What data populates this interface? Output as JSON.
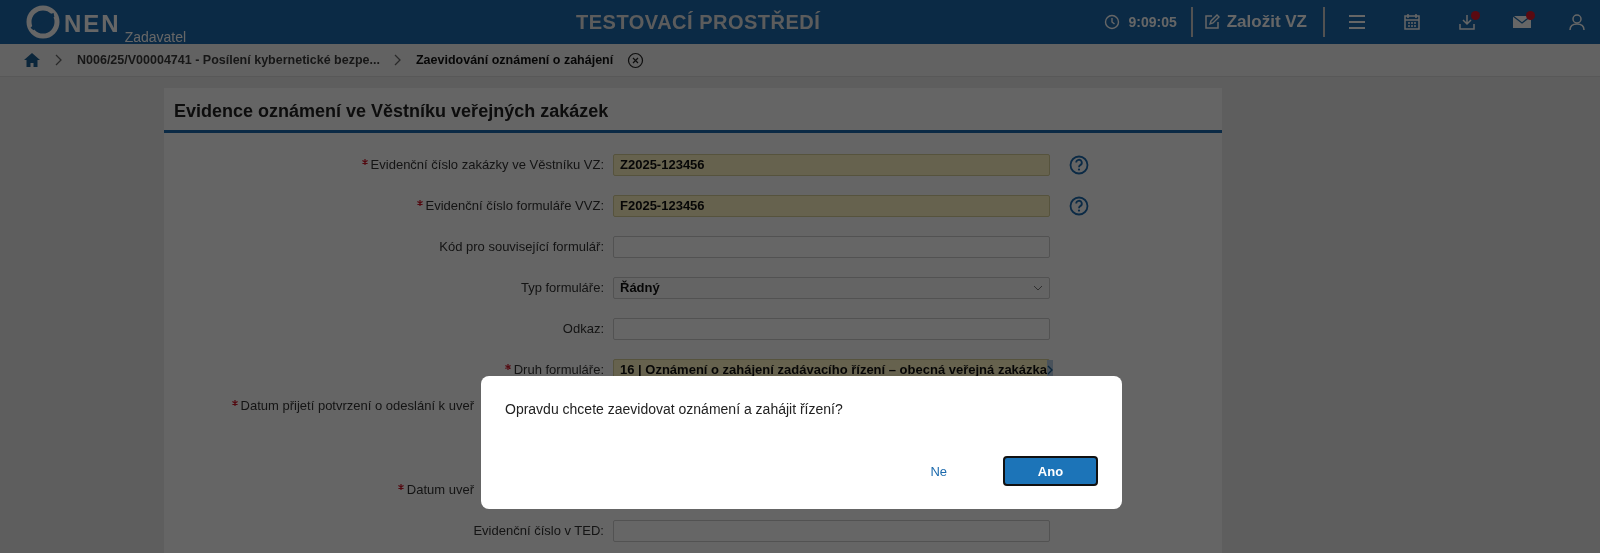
{
  "header": {
    "logo": "NEN",
    "subtitle": "Zadavatel",
    "title": "TESTOVACÍ PROSTŘEDÍ",
    "time": "9:09:05",
    "create_label": "Založit VZ",
    "icons": [
      {
        "kind": "menu",
        "notification": false
      },
      {
        "kind": "calendar",
        "notification": false
      },
      {
        "kind": "download",
        "notification": true
      },
      {
        "kind": "mail",
        "notification": true
      },
      {
        "kind": "user",
        "notification": false
      }
    ]
  },
  "breadcrumb": {
    "items": [
      "N006/25/V00004741 - Posílení kybernetické bezpe...",
      "Zaevidování oznámení o zahájení"
    ]
  },
  "form": {
    "title": "Evidence oznámení ve Věstníku veřejných zakázek",
    "fields": [
      {
        "kind": "text",
        "label": "Evidenční číslo zakázky ve Věstníku VZ:",
        "required": true,
        "value": "Z2025-123456",
        "help": true
      },
      {
        "kind": "text",
        "label": "Evidenční číslo formuláře VVZ:",
        "required": true,
        "value": "F2025-123456",
        "help": true
      },
      {
        "kind": "text",
        "label": "Kód pro související formulář:",
        "required": false,
        "help": false
      },
      {
        "kind": "select",
        "label": "Typ formuláře:",
        "required": false,
        "value": "Řádný",
        "help": false
      },
      {
        "kind": "text",
        "label": "Odkaz:",
        "required": false,
        "help": false
      },
      {
        "kind": "code",
        "label": "Druh formuláře:",
        "required": true,
        "value": "16 | Oznámení o zahájení zadávacího řízení – obecná veřejná zakázka",
        "help": false
      },
      {
        "kind": "covered-tall",
        "label": "Datum přijetí potvrzení o odeslání k uveř",
        "required": true
      },
      {
        "kind": "covered",
        "label": "Datum uveř",
        "required": true
      },
      {
        "kind": "text",
        "label": "Evidenční číslo v TED:",
        "required": false,
        "help": false
      }
    ]
  },
  "dialog": {
    "message": "Opravdu chcete zaevidovat oznámení a zahájit řízení?",
    "buttons": [
      {
        "label": "Ne",
        "kind": "secondary"
      },
      {
        "label": "Ano",
        "kind": "primary"
      }
    ]
  }
}
